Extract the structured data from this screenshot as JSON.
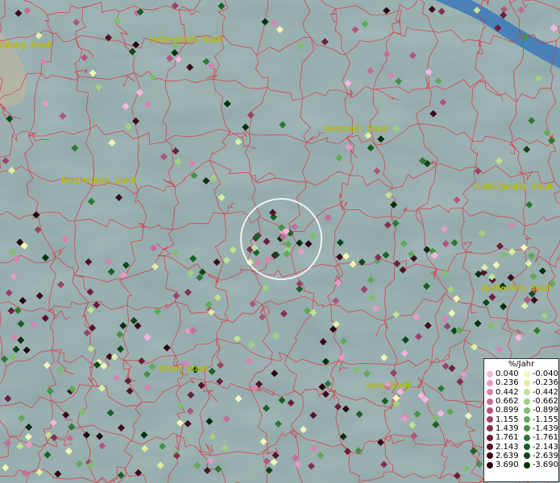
{
  "map": {
    "cities": [
      {
        "name": "rzburg, Stadt"
      },
      {
        "name": "Halberstadt, Stadt"
      },
      {
        "name": "Hettstedt, Stadt"
      },
      {
        "name": "Nordhausen, Stadt"
      },
      {
        "name": "Halle (Saale), Stadt"
      },
      {
        "name": "Weißenfels, Stadt"
      },
      {
        "name": "Erfurt, Stadt"
      },
      {
        "name": "Jena, Stadt"
      }
    ],
    "colors": {
      "terrain": "#8fa8a8",
      "borders": "#e0303c",
      "river": "#2c6fb0",
      "city_label": "#d4d400",
      "highlight_circle": "#ffffff"
    }
  },
  "legend": {
    "title": "%/Jahr",
    "positive": [
      {
        "label": "0.040",
        "color": "#f7b6e0"
      },
      {
        "label": "0.236",
        "color": "#e79ac8"
      },
      {
        "label": "0.442",
        "color": "#d783b2"
      },
      {
        "label": "0.662",
        "color": "#c46c98"
      },
      {
        "label": "0.899",
        "color": "#b0567f"
      },
      {
        "label": "1.155",
        "color": "#994266"
      },
      {
        "label": "1.439",
        "color": "#82304f"
      },
      {
        "label": "1.761",
        "color": "#6a1f3a"
      },
      {
        "label": "2.143",
        "color": "#531229"
      },
      {
        "label": "2.639",
        "color": "#3d0a1c"
      },
      {
        "label": "3.690",
        "color": "#260412"
      }
    ],
    "negative": [
      {
        "label": "-0.040",
        "color": "#f3f7b8"
      },
      {
        "label": "-0.236",
        "color": "#dcefa5"
      },
      {
        "label": "-0.442",
        "color": "#bfe293"
      },
      {
        "label": "-0.662",
        "color": "#9fd280"
      },
      {
        "label": "-0.899",
        "color": "#7fbe6c"
      },
      {
        "label": "-1.155",
        "color": "#5fa858"
      },
      {
        "label": "-1.439",
        "color": "#439044"
      },
      {
        "label": "-1.761",
        "color": "#2c7833"
      },
      {
        "label": "-2.143",
        "color": "#1a5f25"
      },
      {
        "label": "-2.639",
        "color": "#0d4718"
      },
      {
        "label": "-3.690",
        "color": "#03300c"
      }
    ]
  }
}
